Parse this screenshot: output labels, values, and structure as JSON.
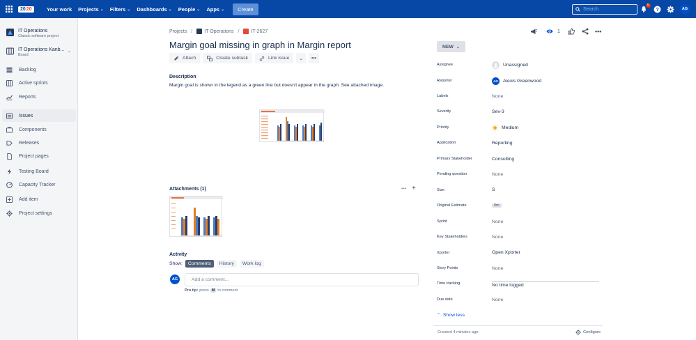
{
  "topnav": {
    "logo_left": "20",
    "logo_right": "20",
    "items": [
      {
        "label": "Your work",
        "chevron": false
      },
      {
        "label": "Projects",
        "chevron": true
      },
      {
        "label": "Filters",
        "chevron": true
      },
      {
        "label": "Dashboards",
        "chevron": true
      },
      {
        "label": "People",
        "chevron": true
      },
      {
        "label": "Apps",
        "chevron": true
      }
    ],
    "create_label": "Create",
    "search_placeholder": "Search",
    "notification_count": "5",
    "avatar_initials": "AG",
    "bg_color": "#0747a6"
  },
  "sidebar": {
    "project_name": "IT Operations",
    "project_sub": "Classic software project",
    "board_name": "IT Operations Kanb...",
    "board_sub": "Board",
    "items": [
      {
        "label": "Backlog",
        "icon": "backlog-icon"
      },
      {
        "label": "Active sprints",
        "icon": "sprint-icon"
      },
      {
        "label": "Reports",
        "icon": "reports-icon"
      },
      {
        "label": "Issues",
        "icon": "issues-icon"
      },
      {
        "label": "Components",
        "icon": "components-icon"
      },
      {
        "label": "Releases",
        "icon": "releases-icon"
      },
      {
        "label": "Project pages",
        "icon": "pages-icon"
      },
      {
        "label": "Testing Board",
        "icon": "lightning-icon"
      },
      {
        "label": "Capacity Tracker",
        "icon": "gauge-icon"
      },
      {
        "label": "Add item",
        "icon": "add-icon"
      },
      {
        "label": "Project settings",
        "icon": "gear-icon"
      }
    ]
  },
  "breadcrumb": {
    "projects": "Projects",
    "project": "IT Operations",
    "issue_key": "IT-2627"
  },
  "issue": {
    "title": "Margin goal missing in graph in Margin report",
    "actions": {
      "attach": "Attach",
      "subtask": "Create subtask",
      "link": "Link issue"
    },
    "description_label": "Description",
    "description": "Margin goal is shown in the legend as a green line but doesn't appear in the graph. See attached image.",
    "attachments_label": "Attachments (1)",
    "activity_label": "Activity",
    "show_label": "Show:",
    "tabs": [
      "Comments",
      "History",
      "Work log"
    ],
    "comment_placeholder": "Add a comment...",
    "comment_avatar": "AG",
    "protip_prefix": "Pro tip:",
    "protip_press": "press",
    "protip_key": "M",
    "protip_suffix": "to comment",
    "watch_count": "1"
  },
  "details": {
    "status": "NEW",
    "fields": [
      {
        "label": "Assignee",
        "value": "Unassigned",
        "kind": "assignee"
      },
      {
        "label": "Reporter",
        "value": "Alexis Greenwood",
        "kind": "reporter"
      },
      {
        "label": "Labels",
        "value": "None",
        "kind": "none"
      },
      {
        "label": "Severity",
        "value": "Sev-3",
        "kind": "text"
      },
      {
        "label": "Priority",
        "value": "Medium",
        "kind": "priority"
      },
      {
        "label": "Application",
        "value": "Reporting",
        "kind": "text"
      },
      {
        "label": "Primary Stakeholder",
        "value": "Consulting",
        "kind": "text"
      },
      {
        "label": "Pending question",
        "value": "None",
        "kind": "none"
      },
      {
        "label": "Size",
        "value": "S",
        "kind": "text"
      },
      {
        "label": "Original Estimate",
        "value": "0m",
        "kind": "tag"
      },
      {
        "label": "Sprint",
        "value": "None",
        "kind": "none"
      },
      {
        "label": "Key Stakeholders",
        "value": "None",
        "kind": "none"
      },
      {
        "label": "Xporter",
        "value": "Open Xporter",
        "kind": "xporter"
      },
      {
        "label": "Story Points",
        "value": "None",
        "kind": "none"
      },
      {
        "label": "Time tracking",
        "value": "No time logged",
        "kind": "time"
      },
      {
        "label": "Due date",
        "value": "None",
        "kind": "none"
      }
    ],
    "show_less": "Show less",
    "created": "Created 4 minutes ago",
    "configure": "Configure",
    "reporter_initials": "AG"
  }
}
